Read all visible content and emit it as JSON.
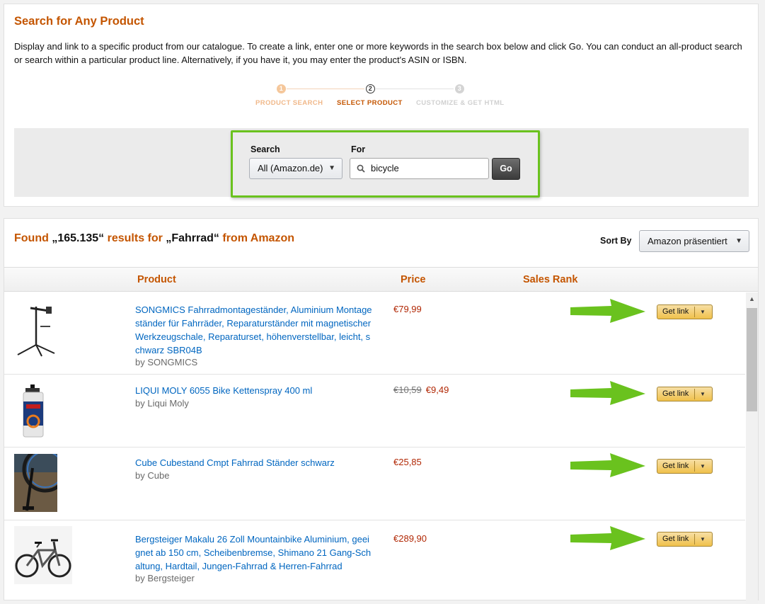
{
  "header": {
    "title": "Search for Any Product",
    "intro": "Display and link to a specific product from our catalogue. To create a link, enter one or more keywords in the search box below and click Go. You can conduct an all-product search or search within a particular product line. Alternatively, if you have it, you may enter the product's ASIN or ISBN."
  },
  "steps": [
    {
      "num": "1",
      "label": "PRODUCT SEARCH"
    },
    {
      "num": "2",
      "label": "SELECT PRODUCT"
    },
    {
      "num": "3",
      "label": "CUSTOMIZE & GET HTML"
    }
  ],
  "search": {
    "search_label": "Search",
    "for_label": "For",
    "category": "All (Amazon.de)",
    "query": "bicycle",
    "go_label": "Go"
  },
  "results": {
    "found_prefix": "Found",
    "count": "„165.135“",
    "mid": "results for",
    "term": "„Fahrrad“",
    "suffix": "from Amazon",
    "sort_label": "Sort By",
    "sort_value": "Amazon präsentiert",
    "col_product": "Product",
    "col_price": "Price",
    "col_rank": "Sales Rank",
    "get_link_label": "Get link",
    "items": [
      {
        "title": "SONGMICS Fahrradmontageständer, Aluminium Montageständer für Fahrräder, Reparaturständer mit magnetischer Werkzeugschale, Reparaturset, höhenverstellbar, leicht, schwarz SBR04B",
        "by": "by SONGMICS",
        "old_price": "",
        "price": "€79,99",
        "thumb_icon": "bike-repair-stand-icon"
      },
      {
        "title": "LIQUI MOLY 6055 Bike Kettenspray 400 ml",
        "by": "by Liqui Moly",
        "old_price": "€10,59",
        "price": "€9,49",
        "thumb_icon": "spray-can-icon"
      },
      {
        "title": "Cube Cubestand Cmpt Fahrrad Ständer schwarz",
        "by": "by Cube",
        "old_price": "",
        "price": "€25,85",
        "thumb_icon": "kickstand-photo-icon"
      },
      {
        "title": "Bergsteiger Makalu 26 Zoll Mountainbike Aluminium, geeignet ab 150 cm, Scheibenbremse, Shimano 21 Gang-Schaltung, Hardtail, Jungen-Fahrrad & Herren-Fahrrad",
        "by": "by Bergsteiger",
        "old_price": "",
        "price": "€289,90",
        "thumb_icon": "mountain-bike-icon"
      }
    ]
  },
  "colors": {
    "accent": "#c45500",
    "link": "#0066c0",
    "price": "#b12704",
    "highlight": "#6ac21e",
    "button": "#f0c14b"
  }
}
